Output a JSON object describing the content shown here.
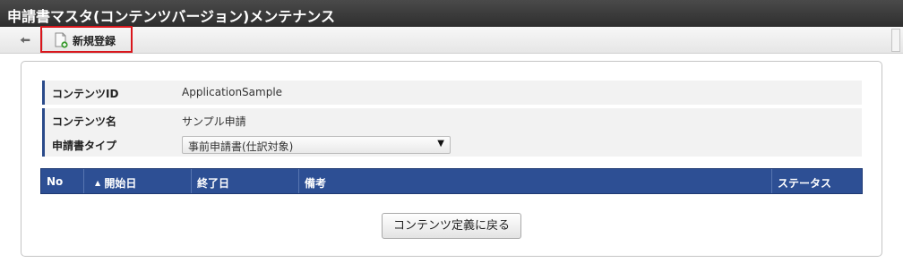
{
  "window": {
    "title": "申請書マスタ(コンテンツバージョン)メンテナンス"
  },
  "toolbar": {
    "back_icon": "arrow-left-icon",
    "new_icon": "new-document-icon",
    "new_label": "新規登録",
    "highlight_color": "#d9161c"
  },
  "form": {
    "content_id_label": "コンテンツID",
    "content_id_value": "ApplicationSample",
    "content_name_label": "コンテンツ名",
    "content_name_value": "サンプル申請",
    "type_label": "申請書タイプ",
    "type_selected": "事前申請書(仕訳対象)"
  },
  "table": {
    "columns": [
      "No",
      "開始日",
      "終了日",
      "備考",
      "ステータス"
    ],
    "sort_indicator": "▲",
    "sorted_column": "開始日",
    "header_color": "#2d4f94",
    "rows": []
  },
  "actions": {
    "back_to_content_label": "コンテンツ定義に戻る"
  }
}
